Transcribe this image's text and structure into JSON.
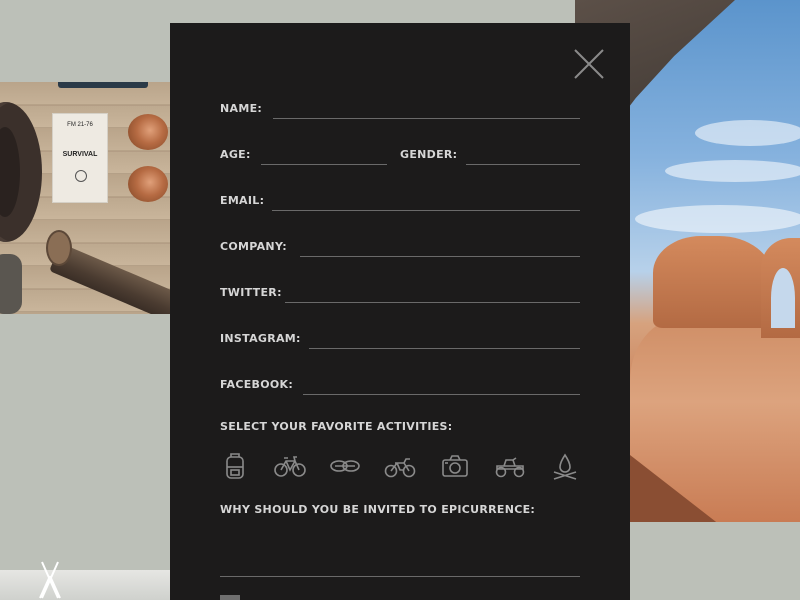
{
  "background": {
    "book": {
      "code": "FM 21-76",
      "title": "SURVIVAL"
    }
  },
  "form": {
    "fields": {
      "name": {
        "label": "NAME:",
        "value": ""
      },
      "age": {
        "label": "AGE:",
        "value": ""
      },
      "gender": {
        "label": "GENDER:",
        "value": ""
      },
      "email": {
        "label": "EMAIL:",
        "value": ""
      },
      "company": {
        "label": "COMPANY:",
        "value": ""
      },
      "twitter": {
        "label": "TWITTER:",
        "value": ""
      },
      "instagram": {
        "label": "INSTAGRAM:",
        "value": ""
      },
      "facebook": {
        "label": "FACEBOOK:",
        "value": ""
      }
    },
    "activities_label": "SELECT YOUR FAVORITE ACTIVITIES:",
    "activities": [
      {
        "icon": "backpack-icon"
      },
      {
        "icon": "bicycle-icon"
      },
      {
        "icon": "rope-icon"
      },
      {
        "icon": "motorcycle-icon"
      },
      {
        "icon": "camera-icon"
      },
      {
        "icon": "atv-icon"
      },
      {
        "icon": "campfire-icon"
      }
    ],
    "why_label": "WHY SHOULD YOU BE INVITED TO EPICURRENCE:",
    "why_value": ""
  },
  "colors": {
    "modal_bg": "#1c1b1b",
    "label": "#d6d6d6",
    "line": "#6a6a6a",
    "icon": "#8a8a8a",
    "page_bg": "#bcc0b8"
  }
}
